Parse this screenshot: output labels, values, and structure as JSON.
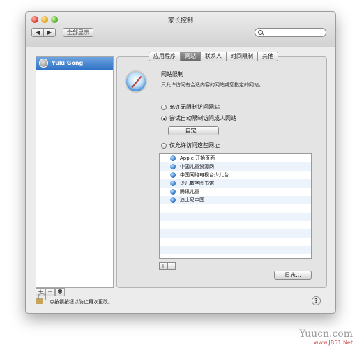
{
  "window": {
    "title": "家长控制"
  },
  "toolbar": {
    "back": "◀",
    "forward": "▶",
    "show_all": "全部显示",
    "search_placeholder": ""
  },
  "sidebar": {
    "user": "Yuki Gong",
    "add": "+",
    "remove": "−",
    "gear": "✱"
  },
  "tabs": [
    {
      "label": "应用程序",
      "active": false
    },
    {
      "label": "网站",
      "active": true
    },
    {
      "label": "联系人",
      "active": false
    },
    {
      "label": "时间限制",
      "active": false
    },
    {
      "label": "其他",
      "active": false
    }
  ],
  "section": {
    "title": "网站限制",
    "description": "只允许访问有合适内容的网站或您指定的网站。"
  },
  "options": [
    {
      "label": "允许无限制访问网站",
      "selected": false
    },
    {
      "label": "尝试自动限制访问成人网站",
      "selected": true
    },
    {
      "label": "仅允许访问这些网址",
      "selected": false
    }
  ],
  "customize_button": "自定...",
  "sites": [
    "Apple 开始页面",
    "中国儿童资源网",
    "中国网络电视台少儿台",
    "少儿数字图书馆",
    "腾讯儿童",
    "迪士尼中国"
  ],
  "sites_controls": {
    "add": "+",
    "remove": "−"
  },
  "log_button": "日志...",
  "footer": {
    "lock_text": "点按锁按钮以防止再次更改。",
    "help": "?"
  },
  "watermark": {
    "main": "Yuucn.com",
    "sub": "www.JB51.Net"
  }
}
